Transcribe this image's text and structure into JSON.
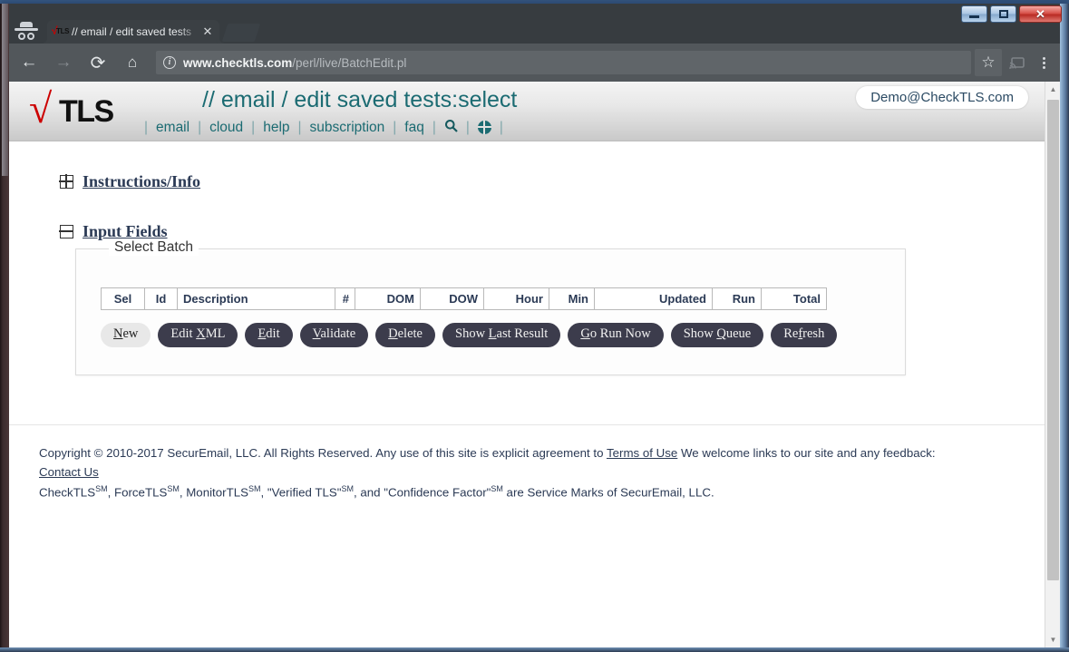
{
  "window": {
    "controls": {
      "minimize": "minimize",
      "maximize": "restore",
      "close": "✕"
    }
  },
  "browser": {
    "incognito": "incognito-mode",
    "tab": {
      "favicon_check": "√",
      "favicon_text": "TLS",
      "title": "// email / edit saved tests",
      "close": "✕"
    },
    "new_tab": "+",
    "toolbar": {
      "back": "←",
      "forward": "→",
      "reload": "⟳",
      "home": "⌂",
      "bookmark": "☆",
      "cast": "cast",
      "menu": "⋮"
    },
    "omnibox": {
      "info": "i",
      "url_host": "www.checktls.com",
      "url_path": "/perl/live/BatchEdit.pl"
    }
  },
  "site": {
    "logo": {
      "check": "√",
      "text": "TLS"
    },
    "title": "// email / edit saved tests:select",
    "user_badge": "Demo@CheckTLS.com",
    "nav": {
      "sep": "|",
      "items": [
        {
          "label": "email"
        },
        {
          "label": "cloud"
        },
        {
          "label": "help"
        },
        {
          "label": "subscription"
        },
        {
          "label": "faq"
        }
      ],
      "search_icon": "search-icon",
      "globe_icon": "globe-icon"
    }
  },
  "main": {
    "sections": [
      {
        "id": "instructions",
        "title": "Instructions/Info",
        "expanded": false,
        "toggle": "expand"
      },
      {
        "id": "input_fields",
        "title": "Input Fields",
        "expanded": true,
        "toggle": "collapse"
      }
    ],
    "panel": {
      "legend": "Select Batch",
      "table": {
        "headers": [
          "Sel",
          "Id",
          "Description",
          "#",
          "DOM",
          "DOW",
          "Hour",
          "Min",
          "Updated",
          "Run",
          "Total"
        ],
        "rows": []
      },
      "buttons": [
        {
          "label": "New",
          "accesskey": "N",
          "pre": "",
          "post": "ew",
          "style": "light"
        },
        {
          "label": "Edit XML",
          "accesskey": "X",
          "pre": "Edit ",
          "post": "ML",
          "style": "dark"
        },
        {
          "label": "Edit",
          "accesskey": "E",
          "pre": "",
          "post": "dit",
          "style": "dark"
        },
        {
          "label": "Validate",
          "accesskey": "V",
          "pre": "",
          "post": "alidate",
          "style": "dark"
        },
        {
          "label": "Delete",
          "accesskey": "D",
          "pre": "",
          "post": "elete",
          "style": "dark"
        },
        {
          "label": "Show Last Result",
          "accesskey": "L",
          "pre": "Show ",
          "post": "ast Result",
          "style": "dark"
        },
        {
          "label": "Go Run Now",
          "accesskey": "G",
          "pre": "",
          "post": "o Run Now",
          "style": "dark"
        },
        {
          "label": "Show Queue",
          "accesskey": "Q",
          "pre": "Show ",
          "post": "ueue",
          "style": "dark"
        },
        {
          "label": "Refresh",
          "accesskey": "f",
          "pre": "Re",
          "post": "resh",
          "style": "dark"
        }
      ]
    }
  },
  "footer": {
    "line1_a": "Copyright © 2010-2017 SecurEmail, LLC. All Rights Reserved. Any use of this site is explicit agreement to ",
    "terms_link": "Terms of Use",
    "line1_b": " We welcome links to our site and any feedback:",
    "contact_link": "Contact Us",
    "line3_a": "CheckTLS",
    "sm1": "SM",
    "line3_b": ", ForceTLS",
    "sm2": "SM",
    "line3_c": ", MonitorTLS",
    "sm3": "SM",
    "line3_d": ", \"Verified TLS\"",
    "sm4": "SM",
    "line3_e": ", and \"Confidence Factor\"",
    "sm5": "SM",
    "line3_f": " are Service Marks of SecurEmail, LLC."
  },
  "scrollbar": {
    "up": "▲",
    "down": "▼"
  },
  "colors": {
    "accent_teal": "#1b6b72",
    "logo_red": "#cc0000",
    "btn_dark": "#3c3c4c",
    "text_navy": "#2b3a55"
  }
}
